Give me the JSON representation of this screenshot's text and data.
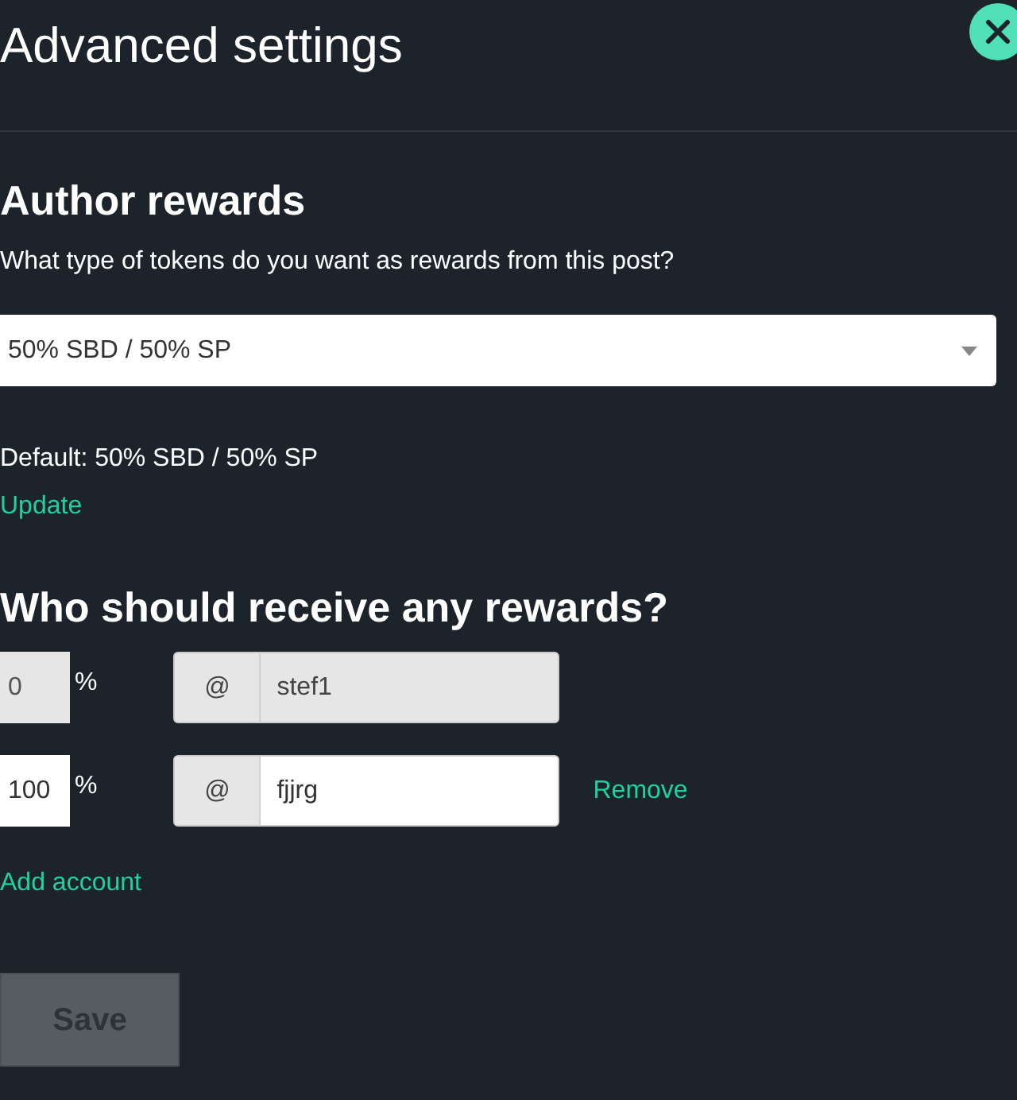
{
  "dialog": {
    "title": "Advanced settings"
  },
  "author_rewards": {
    "heading": "Author rewards",
    "question": "What type of tokens do you want as rewards from this post?",
    "select": {
      "value": "50% SBD / 50% SP"
    },
    "default_text": "Default: 50% SBD / 50% SP",
    "update_link": "Update"
  },
  "beneficiaries": {
    "heading": "Who should receive any rewards?",
    "rows": [
      {
        "percent": "0",
        "percent_sign": "%",
        "at_sign": "@",
        "account": "stef1",
        "disabled": true
      },
      {
        "percent": "100",
        "percent_sign": "%",
        "at_sign": "@",
        "account": "fjjrg",
        "disabled": false,
        "remove_label": "Remove"
      }
    ],
    "add_account": "Add account"
  },
  "save_button": {
    "label": "Save",
    "disabled": true
  }
}
